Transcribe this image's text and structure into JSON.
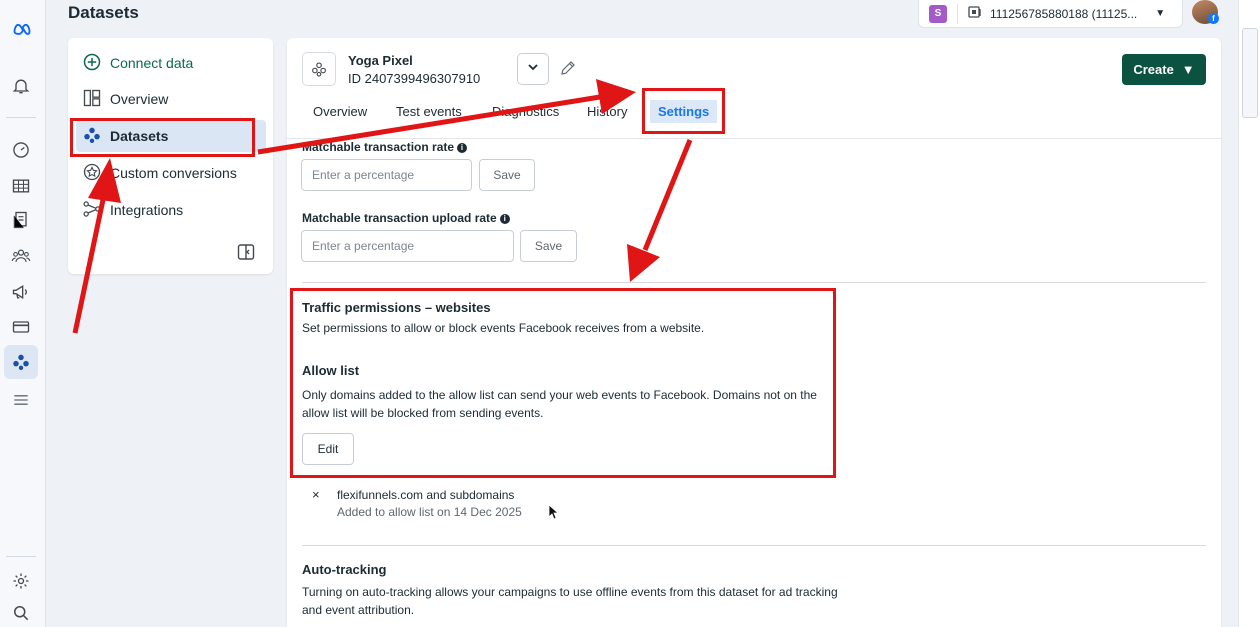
{
  "header": {
    "page_title": "Datasets",
    "account_badge": "S",
    "account_id": "111256785880188 (11125..."
  },
  "rail": {
    "icons": [
      "meta-logo-icon",
      "bell-icon",
      "gauge-icon",
      "table-icon",
      "pages-icon",
      "audience-icon",
      "megaphone-icon",
      "billing-card-icon",
      "datasets-icon",
      "menu-icon",
      "settings-icon",
      "search-icon"
    ]
  },
  "nav": {
    "items": [
      {
        "label": "Connect data",
        "icon": "plus-circle-icon"
      },
      {
        "label": "Overview",
        "icon": "layout-icon"
      },
      {
        "label": "Datasets",
        "icon": "datasets-icon",
        "active": true
      },
      {
        "label": "Custom conversions",
        "icon": "star-badge-icon"
      },
      {
        "label": "Integrations",
        "icon": "share-nodes-icon"
      }
    ]
  },
  "dataset": {
    "name": "Yoga Pixel",
    "id": "ID 2407399496307910",
    "create_label": "Create"
  },
  "tabs": [
    {
      "label": "Overview"
    },
    {
      "label": "Test events"
    },
    {
      "label": "Diagnostics"
    },
    {
      "label": "History"
    },
    {
      "label": "Settings",
      "active": true
    }
  ],
  "settings": {
    "rate_label": "Matchable transaction rate",
    "rate_placeholder": "Enter a percentage",
    "rate_save": "Save",
    "upload_label": "Matchable transaction upload rate",
    "upload_placeholder": "Enter a percentage",
    "upload_save": "Save",
    "traffic_title": "Traffic permissions – websites",
    "traffic_desc": "Set permissions to allow or block events Facebook receives from a website.",
    "allow_title": "Allow list",
    "allow_desc": "Only domains added to the allow list can send your web events to Facebook. Domains not on the allow list will be blocked from sending events.",
    "edit_label": "Edit",
    "domain_remove": "×",
    "domain_name": "flexifunnels.com and subdomains",
    "domain_added": "Added to allow list on 14 Dec 2025",
    "auto_title": "Auto-tracking",
    "auto_desc": "Turning on auto-tracking allows your campaigns to use offline events from this dataset for ad tracking and event attribution."
  },
  "colors": {
    "annotation_red": "#e01515",
    "create_green": "#0b5240",
    "active_tab_blue": "#1877f2",
    "connect_green": "#0a6b49"
  }
}
